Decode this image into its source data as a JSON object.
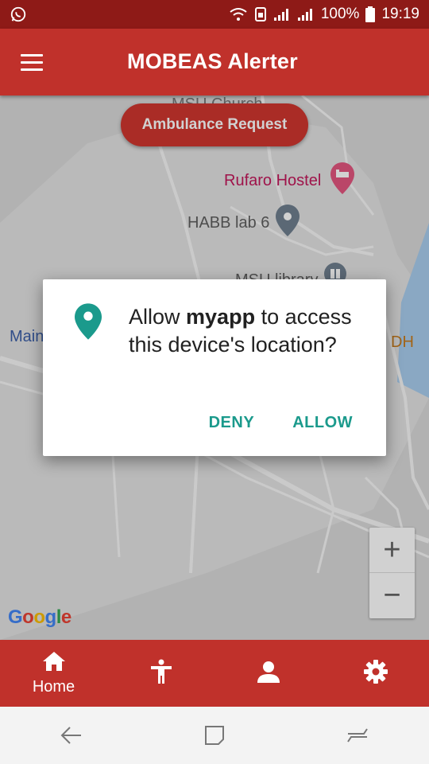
{
  "status_bar": {
    "battery_text": "100%",
    "time": "19:19",
    "notification_icon": "whatsapp-icon",
    "icons": [
      "wifi-icon",
      "sim-icon",
      "signal-icon",
      "signal-icon",
      "battery-icon"
    ]
  },
  "app_bar": {
    "title": "MOBEAS Alerter",
    "menu_icon": "hamburger-menu-icon"
  },
  "map": {
    "ambulance_button_label": "Ambulance Request",
    "labels": {
      "church": "MSU Church",
      "rufaro": "Rufaro Hostel",
      "habb": "HABB lab 6",
      "library": "MSU library",
      "main": "Main",
      "dh": "DH"
    },
    "zoom_in_label": "+",
    "zoom_out_label": "−",
    "logo_text": "Google"
  },
  "dialog": {
    "message_prefix": "Allow ",
    "app_name": "myapp",
    "message_suffix": " to access this device's location?",
    "deny_label": "DENY",
    "allow_label": "ALLOW",
    "icon": "location-pin-icon"
  },
  "bottom_nav": {
    "items": [
      {
        "label": "Home",
        "icon": "home-icon"
      },
      {
        "label": "",
        "icon": "accessibility-icon"
      },
      {
        "label": "",
        "icon": "person-icon"
      },
      {
        "label": "",
        "icon": "settings-icon"
      }
    ]
  },
  "system_nav": {
    "icons": [
      "back-icon",
      "recents-icon",
      "switch-icon"
    ]
  },
  "colors": {
    "primary": "#c0312b",
    "status_bar": "#8e1a17",
    "accent": "#1b9a8c"
  }
}
